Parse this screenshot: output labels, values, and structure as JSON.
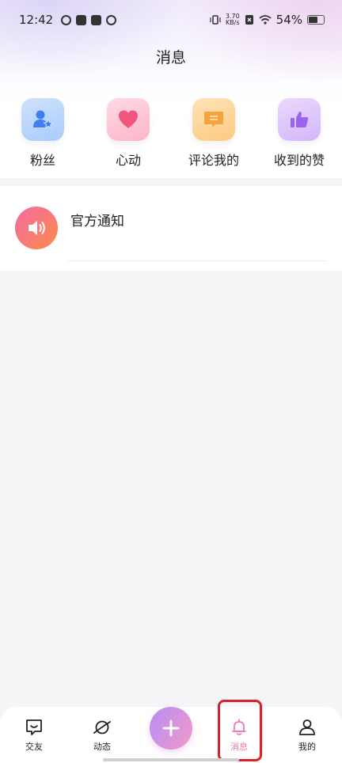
{
  "status_bar": {
    "time": "12:42",
    "speed_value": "3.70",
    "speed_unit": "KB/s",
    "battery": "54%",
    "battery_level": 0.54
  },
  "header": {
    "title": "消息"
  },
  "quick_actions": [
    {
      "label": "粉丝",
      "icon": "fans-icon",
      "color": "#4a8df5"
    },
    {
      "label": "心动",
      "icon": "heart-icon",
      "color": "#f06a8a"
    },
    {
      "label": "评论我的",
      "icon": "comment-icon",
      "color": "#f7a940"
    },
    {
      "label": "收到的赞",
      "icon": "thumbs-up-icon",
      "color": "#a679ef"
    }
  ],
  "notifications": [
    {
      "title": "官方通知",
      "icon": "speaker-icon"
    }
  ],
  "bottom_nav": {
    "items": [
      {
        "label": "交友",
        "icon": "chat-face-icon"
      },
      {
        "label": "动态",
        "icon": "planet-icon"
      },
      {
        "label": "消息",
        "icon": "bell-icon",
        "active": true
      },
      {
        "label": "我的",
        "icon": "person-icon"
      }
    ],
    "center_button": {
      "icon": "plus-icon"
    }
  },
  "colors": {
    "accent_pink": "#f07bb4",
    "highlight_red": "#d9212b"
  }
}
